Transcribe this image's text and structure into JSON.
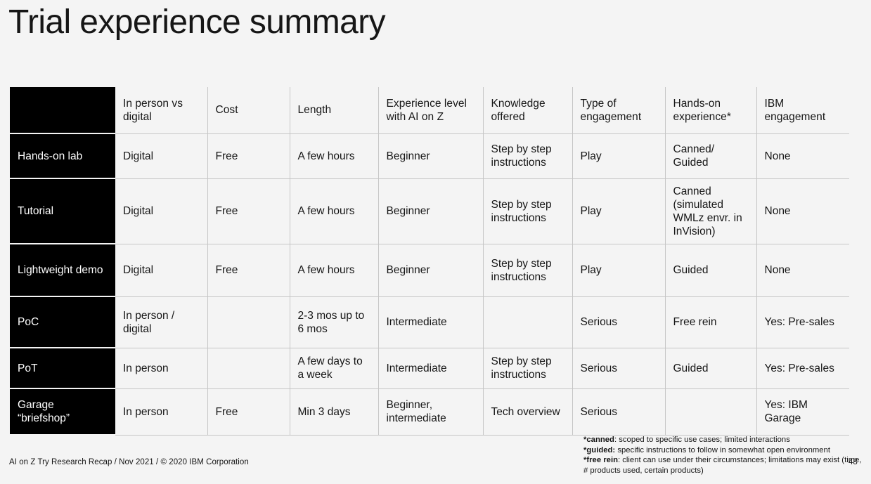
{
  "slide": {
    "title": "Trial experience summary",
    "background_color": "#f4f4f4",
    "accent_color": "#000000"
  },
  "table": {
    "corner_label": "",
    "columns": [
      "",
      "In person vs digital",
      "Cost",
      "Length",
      "Experience level with AI on Z",
      "Knowledge offered",
      "Type of engagement",
      "Hands-on experience*",
      "IBM engagement"
    ],
    "rows": [
      {
        "label": "Hands-on lab",
        "cells": [
          "Digital",
          "Free",
          "A few hours",
          "Beginner",
          "Step by step instructions",
          "Play",
          "Canned/ Guided",
          "None"
        ]
      },
      {
        "label": "Tutorial",
        "cells": [
          "Digital",
          "Free",
          "A few hours",
          "Beginner",
          "Step by step instructions",
          "Play",
          "Canned (simulated WMLz envr. in InVision)",
          "None"
        ]
      },
      {
        "label": "Lightweight demo",
        "cells": [
          "Digital",
          "Free",
          "A few hours",
          "Beginner",
          "Step by step instructions",
          "Play",
          "Guided",
          "None"
        ]
      },
      {
        "label": "PoC",
        "cells": [
          "In person / digital",
          "",
          "2-3 mos up to 6 mos",
          "Intermediate",
          "",
          "Serious",
          "Free rein",
          "Yes: Pre-sales"
        ]
      },
      {
        "label": "PoT",
        "cells": [
          "In person",
          "",
          "A few days to a week",
          "Intermediate",
          "Step by step instructions",
          "Serious",
          "Guided",
          "Yes: Pre-sales"
        ]
      },
      {
        "label": "Garage “briefshop”",
        "cells": [
          "In person",
          "Free",
          "Min 3 days",
          "Beginner, intermediate",
          "Tech overview",
          "Serious",
          "",
          "Yes: IBM Garage"
        ]
      }
    ]
  },
  "footnotes": [
    {
      "term": "*canned",
      "separator": ": ",
      "text": "scoped to specific use cases; limited interactions"
    },
    {
      "term": "*guided:",
      "separator": " ",
      "text": "specific instructions to follow in somewhat open environment"
    },
    {
      "term": "*free rein",
      "separator": ": ",
      "text": "client can use under their circumstances; limitations may exist (time, # products used, certain products)"
    }
  ],
  "footer": {
    "left": "AI on Z Try Research Recap / Nov 2021 / © 2020 IBM Corporation",
    "page_number": "48"
  }
}
